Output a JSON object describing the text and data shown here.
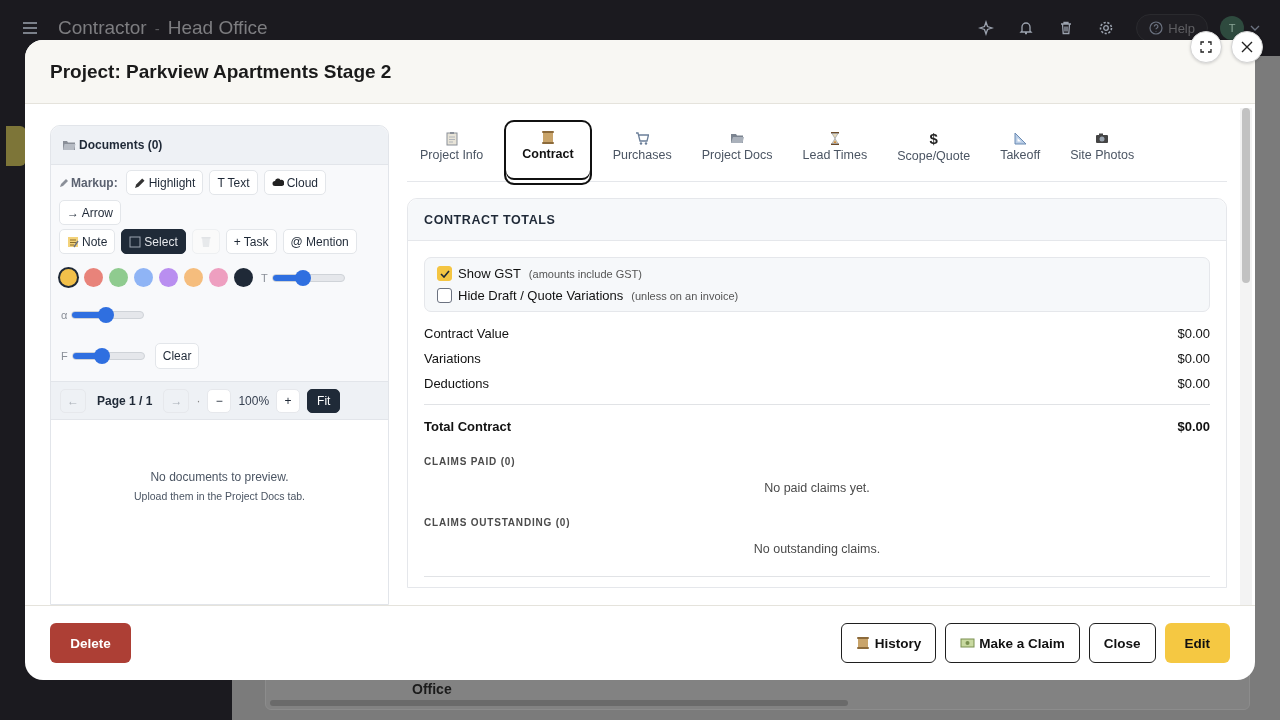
{
  "app_bar": {
    "title": "Contractor",
    "separator": "-",
    "subtitle": "Head Office",
    "help": "Help",
    "avatar": "T"
  },
  "background_page": {
    "text": "Office"
  },
  "modal": {
    "title": "Project: Parkview Apartments Stage 2"
  },
  "documents": {
    "title": "Documents (0)",
    "markup_label": "Markup:",
    "markup_tools": [
      {
        "label": "Highlight",
        "selected": false
      },
      {
        "label": "T Text",
        "selected": false
      },
      {
        "label": "Cloud",
        "selected": false
      },
      {
        "label": "→ Arrow",
        "selected": false
      }
    ],
    "action_tools": [
      {
        "label": "Note",
        "selected": false,
        "disabled": false
      },
      {
        "label": "Select",
        "selected": true,
        "disabled": false
      },
      {
        "selected": false,
        "disabled": true
      },
      {
        "label": "+ Task",
        "selected": false,
        "disabled": false
      },
      {
        "label": "@ Mention",
        "selected": false,
        "disabled": false
      }
    ],
    "colors": [
      {
        "color": "#f2c04a",
        "selected": true
      },
      {
        "color": "#e8837a",
        "selected": false
      },
      {
        "color": "#8fcb8f",
        "selected": false
      },
      {
        "color": "#8fb4f5",
        "selected": false
      },
      {
        "color": "#b98ef0",
        "selected": false
      },
      {
        "color": "#f5bd7d",
        "selected": false
      },
      {
        "color": "#ee9fc0",
        "selected": false
      },
      {
        "color": "#1f2937",
        "selected": false
      }
    ],
    "sliders": [
      {
        "label": "T",
        "level": 0.42
      },
      {
        "label": "α",
        "level": 0.48
      },
      {
        "label": "F",
        "level": 0.41
      }
    ],
    "clear": "Clear",
    "pager": {
      "prev": "←",
      "prev_disabled": true,
      "page": "Page 1 / 1",
      "next": "→",
      "next_disabled": true,
      "dot": "·",
      "minus": "−",
      "zoom": "100%",
      "plus": "+",
      "fit": "Fit"
    },
    "empty": {
      "title": "No documents to preview.",
      "hint": "Upload them in the Project Docs tab."
    }
  },
  "tabs": [
    {
      "label": "Project Info",
      "selected": false
    },
    {
      "label": "Contract",
      "selected": true
    },
    {
      "label": "Purchases",
      "selected": false
    },
    {
      "label": "Project Docs",
      "selected": false
    },
    {
      "label": "Lead Times",
      "selected": false
    },
    {
      "label": "Scope/Quote",
      "glyph": "$",
      "selected": false
    },
    {
      "label": "Takeoff",
      "selected": false
    },
    {
      "label": "Site Photos",
      "selected": false
    }
  ],
  "totals": {
    "title": "CONTRACT TOTALS",
    "options": [
      {
        "label": "Show GST",
        "note": "(amounts include GST)",
        "checked": true
      },
      {
        "label": "Hide Draft / Quote Variations",
        "note": "(unless on an invoice)",
        "checked": false
      }
    ],
    "lines": [
      {
        "label": "Contract Value",
        "value": "$0.00"
      },
      {
        "label": "Variations",
        "value": "$0.00"
      },
      {
        "label": "Deductions",
        "value": "$0.00"
      }
    ],
    "total": {
      "label": "Total Contract",
      "value": "$0.00"
    },
    "sections": [
      {
        "title": "CLAIMS PAID (0)",
        "empty": "No paid claims yet."
      },
      {
        "title": "CLAIMS OUTSTANDING (0)",
        "empty": "No outstanding claims."
      }
    ]
  },
  "footer": {
    "delete": "Delete",
    "buttons": [
      {
        "label": "History",
        "kind": "outline"
      },
      {
        "label": "Make a Claim",
        "kind": "outline"
      },
      {
        "label": "Close",
        "kind": "outline"
      },
      {
        "label": "Edit",
        "kind": "primary"
      }
    ]
  }
}
